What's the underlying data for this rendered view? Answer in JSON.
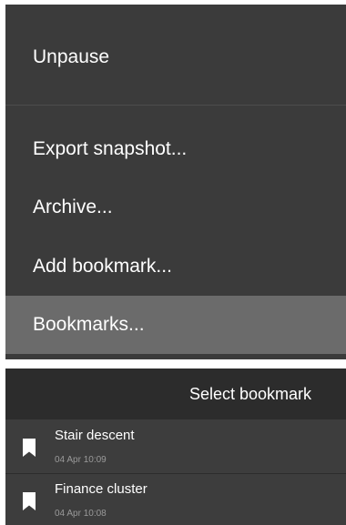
{
  "context_menu": {
    "items": [
      {
        "label": "Unpause"
      },
      {
        "label": "Export snapshot..."
      },
      {
        "label": "Archive..."
      },
      {
        "label": "Add bookmark..."
      },
      {
        "label": "Bookmarks..."
      }
    ],
    "highlighted_item": "Bookmarks...",
    "colors": {
      "background": "#3b3b3b",
      "highlight": "#6b6b6b",
      "text": "#ffffff"
    }
  },
  "bookmark_dialog": {
    "title": "Select bookmark",
    "bookmarks": [
      {
        "name": "Stair descent",
        "date": "04 Apr 10:09",
        "icon": "bookmark-icon"
      },
      {
        "name": "Finance cluster",
        "date": "04 Apr 10:08",
        "icon": "bookmark-icon"
      }
    ],
    "colors": {
      "header": "#2c2c2c",
      "row": "#3d3d3d",
      "secondary_text": "#9a9a9a"
    }
  }
}
